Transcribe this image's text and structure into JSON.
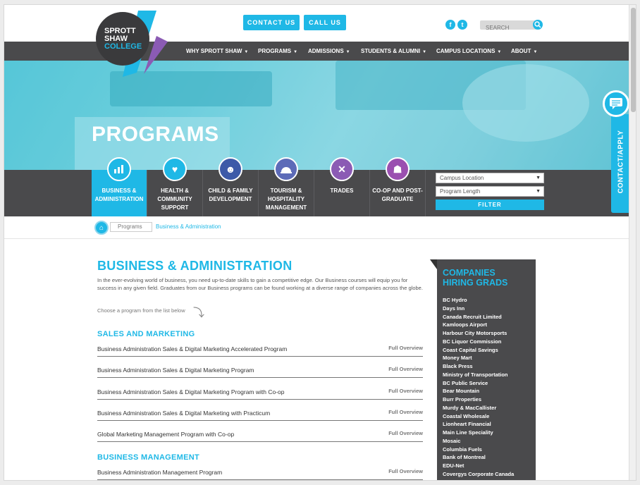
{
  "header": {
    "logo_text": [
      "SPROTT",
      "SHAW",
      "COLLEGE"
    ],
    "contact_us": "CONTACT US",
    "call_us": "CALL US",
    "search_placeholder": "SEARCH"
  },
  "nav": [
    {
      "label": "WHY SPROTT SHAW"
    },
    {
      "label": "PROGRAMS"
    },
    {
      "label": "ADMISSIONS"
    },
    {
      "label": "STUDENTS & ALUMNI"
    },
    {
      "label": "CAMPUS LOCATIONS"
    },
    {
      "label": "ABOUT"
    }
  ],
  "hero": {
    "title": "PROGRAMS"
  },
  "categories": [
    {
      "label": "BUSINESS & ADMINISTRATION",
      "icon": "chart-icon",
      "active": true
    },
    {
      "label": "HEALTH & COMMUNITY SUPPORT",
      "icon": "heart-icon"
    },
    {
      "label": "CHILD & FAMILY DEVELOPMENT",
      "icon": "family-icon"
    },
    {
      "label": "TOURISM & HOSPITALITY MANAGEMENT",
      "icon": "service-bell-icon"
    },
    {
      "label": "TRADES",
      "icon": "tools-icon"
    },
    {
      "label": "CO-OP AND POST-GRADUATE",
      "icon": "people-icon"
    }
  ],
  "filters": {
    "campus": "Campus Location",
    "length": "Program Length",
    "button": "FILTER"
  },
  "breadcrumb": {
    "items": [
      "Programs",
      "Business & Administration"
    ]
  },
  "main": {
    "title": "BUSINESS & ADMINISTRATION",
    "intro": "In the ever-evolving world of business, you need up-to-date skills to gain a competitive edge. Our Business courses will equip you for success in any given field. Graduates from our Business programs can be found working at a diverse range of companies across the globe.",
    "choose": "Choose a program from the list below",
    "overview_label": "Full Overview",
    "sections": [
      {
        "heading": "SALES AND MARKETING",
        "programs": [
          "Business Administration Sales & Digital Marketing Accelerated Program",
          "Business Administration Sales & Digital Marketing Program",
          "Business Administration Sales & Digital Marketing Program with Co-op",
          "Business Administration Sales & Digital Marketing with Practicum",
          "Global Marketing Management Program with Co-op"
        ]
      },
      {
        "heading": "BUSINESS MANAGEMENT",
        "programs": [
          "Business Administration Management Program"
        ]
      }
    ]
  },
  "sidebar": {
    "heading_line1": "COMPANIES",
    "heading_line2": "HIRING GRADS",
    "companies": [
      "BC Hydro",
      "Days Inn",
      "Canada Recruit Limited",
      "Kamloops Airport",
      "Harbour City Motorsports",
      "BC Liquor Commission",
      "Coast Capital Savings",
      "Money Mart",
      "Black Press",
      "Ministry of Transportation",
      "BC Public Service",
      "Bear Mountain",
      "Burr Properties",
      "Murdy & MacCallister",
      "Coastal Wholesale",
      "Lionheart Financial",
      "Main Line Speciality",
      "Mosaic",
      "Columbia Fuels",
      "Bank of Montreal",
      "EDU-Net",
      "Covergys Corporate Canada"
    ]
  },
  "contact_tab": "CONTACT/APPLY",
  "colors": {
    "accent": "#1fb8e6",
    "dark": "#4a4a4c"
  }
}
